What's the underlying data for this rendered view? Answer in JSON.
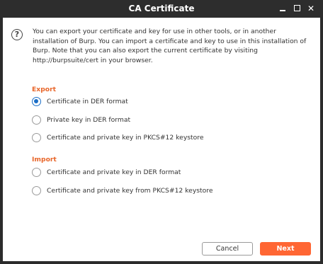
{
  "window": {
    "title": "CA Certificate"
  },
  "dialog": {
    "intro": "You can export your certificate and key for use in other tools, or in another installation of Burp. You can import a certificate and key to use in this installation of Burp. Note that you can also export the current certificate by visiting http://burpsuite/cert in your browser.",
    "export_title": "Export",
    "import_title": "Import",
    "export_options": [
      {
        "label": "Certificate in DER format",
        "selected": true
      },
      {
        "label": "Private key in DER format",
        "selected": false
      },
      {
        "label": "Certificate and private key in PKCS#12 keystore",
        "selected": false
      }
    ],
    "import_options": [
      {
        "label": "Certificate and private key in DER format",
        "selected": false
      },
      {
        "label": "Certificate and private key from PKCS#12 keystore",
        "selected": false
      }
    ]
  },
  "buttons": {
    "cancel": "Cancel",
    "next": "Next"
  },
  "colors": {
    "accent": "#ff6633",
    "section": "#e8662a",
    "radio_selected": "#1a6ec7",
    "titlebar": "#2d2d2d"
  }
}
